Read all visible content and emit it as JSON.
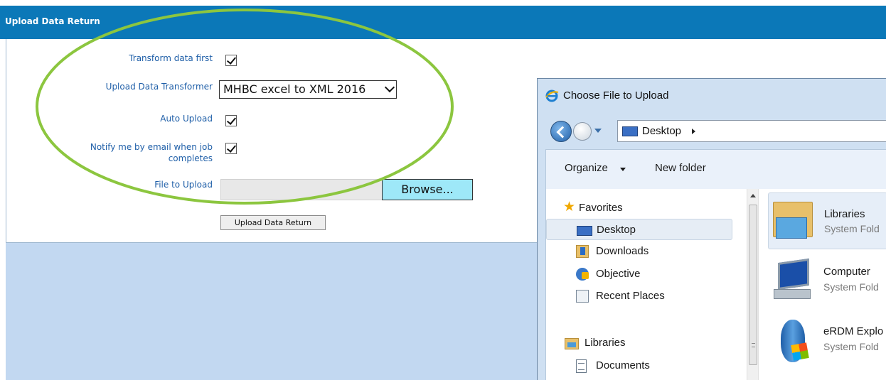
{
  "form": {
    "header_title": "Upload Data Return",
    "transform_label": "Transform data first",
    "transform_checked": true,
    "transformer_label": "Upload Data Transformer",
    "transformer_value": "MHBC excel to XML 2016",
    "auto_upload_label": "Auto Upload",
    "auto_upload_checked": true,
    "notify_label_line1": "Notify me by email when job",
    "notify_label_line2": "completes",
    "notify_checked": true,
    "file_label": "File to Upload",
    "browse_label": "Browse...",
    "upload_button_label": "Upload Data Return"
  },
  "annotation": {
    "ellipse_color": "#8cc63f"
  },
  "dialog": {
    "title": "Choose File to Upload",
    "address_location": "Desktop",
    "toolbar": {
      "organize_label": "Organize",
      "new_folder_label": "New folder"
    },
    "nav_items": [
      {
        "label": "Favorites",
        "icon": "star-icon"
      },
      {
        "label": "Desktop",
        "icon": "desktop-icon",
        "selected": true
      },
      {
        "label": "Downloads",
        "icon": "downloads-icon"
      },
      {
        "label": "Objective",
        "icon": "objective-icon"
      },
      {
        "label": "Recent Places",
        "icon": "recent-places-icon"
      },
      {
        "label": "Libraries",
        "icon": "libraries-icon"
      },
      {
        "label": "Documents",
        "icon": "documents-icon"
      }
    ],
    "files": [
      {
        "name": "Libraries",
        "type": "System Fold",
        "icon": "libraries-folder-icon"
      },
      {
        "name": "Computer",
        "type": "System Fold",
        "icon": "computer-icon"
      },
      {
        "name": "eRDM Explo",
        "type": "System Fold",
        "icon": "erdm-explorer-icon"
      }
    ]
  },
  "colors": {
    "header_bg": "#0b78b8",
    "label_text": "#1f5fa8",
    "lower_bg": "#c2d8f1",
    "browse_bg": "#9ee8f8"
  }
}
